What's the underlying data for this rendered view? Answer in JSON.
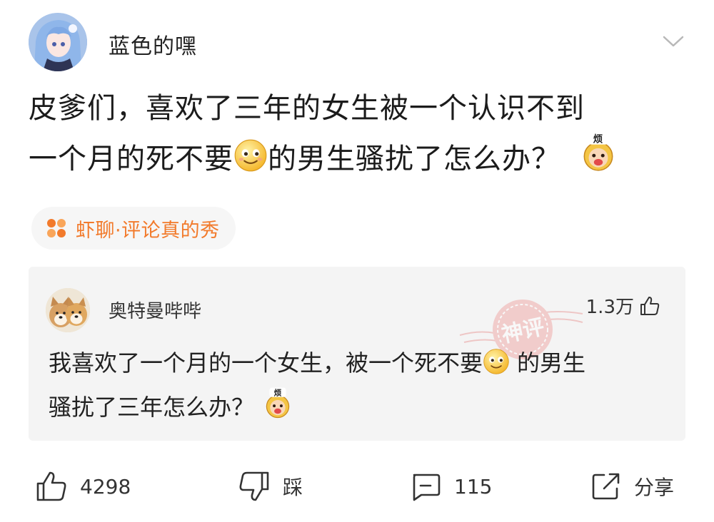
{
  "post": {
    "author": "蓝色的嘿",
    "title_lines": [
      "皮爹们，喜欢了三年的女生被一个认识不到",
      "一个月的死不要",
      "的男生骚扰了怎么办？"
    ],
    "topic": "虾聊·评论真的秀"
  },
  "emojis": {
    "smile": "smiley-face-icon",
    "annoyed": "annoyed-monkey-icon",
    "annoyed_text": "烦"
  },
  "comment": {
    "author": "奥特曼哔哔",
    "likes": "1.3万",
    "stamp": "神评",
    "text_lines": [
      "我喜欢了一个月的一个女生，被一个死不要",
      "的男生",
      "骚扰了三年怎么办？"
    ]
  },
  "actions": {
    "likes": "4298",
    "dislike": "踩",
    "comments": "115",
    "share": "分享"
  },
  "colors": {
    "topic": "#f27a2b",
    "card": "#f4f4f4",
    "stamp": "#e8908e"
  }
}
